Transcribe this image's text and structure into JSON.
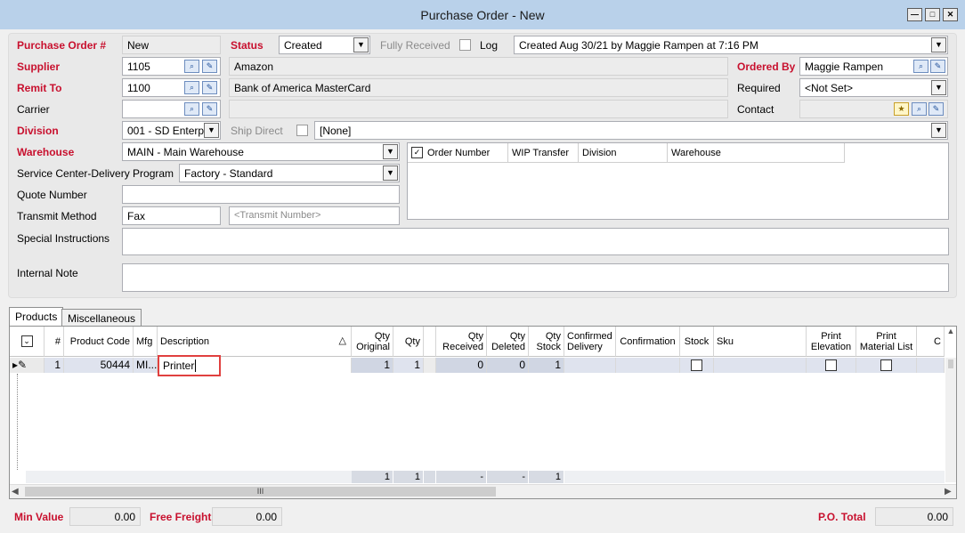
{
  "window": {
    "title": "Purchase Order - New"
  },
  "header": {
    "po_number": {
      "label": "Purchase Order #",
      "value": "New"
    },
    "status": {
      "label": "Status",
      "value": "Created"
    },
    "fully_received_label": "Fully Received",
    "log_label": "Log",
    "created_info": "Created Aug 30/21 by Maggie Rampen at 7:16 PM",
    "supplier": {
      "label": "Supplier",
      "code": "1105",
      "name": "Amazon"
    },
    "ordered_by": {
      "label": "Ordered By",
      "value": "Maggie Rampen"
    },
    "remit_to": {
      "label": "Remit To",
      "code": "1100",
      "name": "Bank of America MasterCard"
    },
    "required": {
      "label": "Required",
      "value": "<Not Set>"
    },
    "carrier": {
      "label": "Carrier",
      "code": "",
      "name": ""
    },
    "contact": {
      "label": "Contact",
      "value": ""
    },
    "division": {
      "label": "Division",
      "value": "001 - SD Enterpr"
    },
    "ship_direct": {
      "label": "Ship Direct",
      "value": "[None]"
    },
    "warehouse": {
      "label": "Warehouse",
      "value": "MAIN - Main Warehouse"
    },
    "service_center": {
      "label": "Service Center-Delivery Program",
      "value": "Factory - Standard"
    },
    "quote_number": {
      "label": "Quote Number",
      "value": ""
    },
    "transmit_method": {
      "label": "Transmit Method",
      "value": "Fax",
      "number_placeholder": "<Transmit Number>"
    },
    "special_instructions": {
      "label": "Special Instructions",
      "value": ""
    },
    "internal_note": {
      "label": "Internal Note",
      "value": ""
    }
  },
  "orders_panel": {
    "columns": [
      "Order Number",
      "WIP Transfer",
      "Division",
      "Warehouse"
    ]
  },
  "tabs": [
    {
      "label": "Products"
    },
    {
      "label": "Miscellaneous"
    }
  ],
  "grid": {
    "columns": {
      "num": "#",
      "product_code": "Product Code",
      "mfg": "Mfg",
      "description": "Description",
      "qty_original": "Qty Original",
      "qty": "Qty",
      "qty_received": "Qty Received",
      "qty_deleted": "Qty Deleted",
      "qty_stock": "Qty Stock",
      "confirmed_delivery": "Confirmed Delivery",
      "confirmation": "Confirmation",
      "stock": "Stock",
      "sku": "Sku",
      "print_elevation": "Print Elevation",
      "print_material_list": "Print Material List",
      "extra": "C"
    },
    "rows": [
      {
        "num": "1",
        "product_code": "50444",
        "mfg": "MI...",
        "description": "Printer",
        "qty_original": "1",
        "qty": "1",
        "qty_received": "0",
        "qty_deleted": "0",
        "qty_stock": "1"
      }
    ],
    "totals": {
      "qty_original": "1",
      "qty": "1",
      "qty_received": "-",
      "qty_deleted": "-",
      "qty_stock": "1"
    },
    "scroll_grip": "III"
  },
  "footer": {
    "min_value": {
      "label": "Min Value",
      "value": "0.00"
    },
    "free_freight": {
      "label": "Free Freight",
      "value": "0.00"
    },
    "po_total": {
      "label": "P.O. Total",
      "value": "0.00"
    }
  },
  "colors": {
    "required_label": "#c8102e",
    "titlebar": "#b9d1ea",
    "highlight": "#e0403f"
  }
}
